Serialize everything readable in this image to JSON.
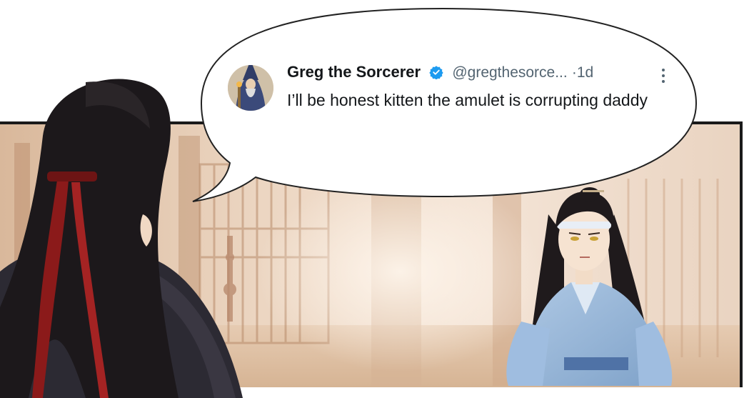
{
  "tweet": {
    "display_name": "Greg the Sorcerer",
    "handle": "@gregthesorce...",
    "separator": "·",
    "time": "1d",
    "text": "I’ll be honest kitten the amulet is corrupting daddy",
    "avatar_icon": "wizard-avatar-icon",
    "verified_icon": "verified-badge-icon",
    "more_icon": "more-vertical-icon"
  },
  "colors": {
    "verified": "#1d9bf0",
    "text": "#14171a",
    "muted": "#536471",
    "wall": "#e8d3bf",
    "hair": "#1e1b1d",
    "robe_blue": "#8fb3d8"
  }
}
